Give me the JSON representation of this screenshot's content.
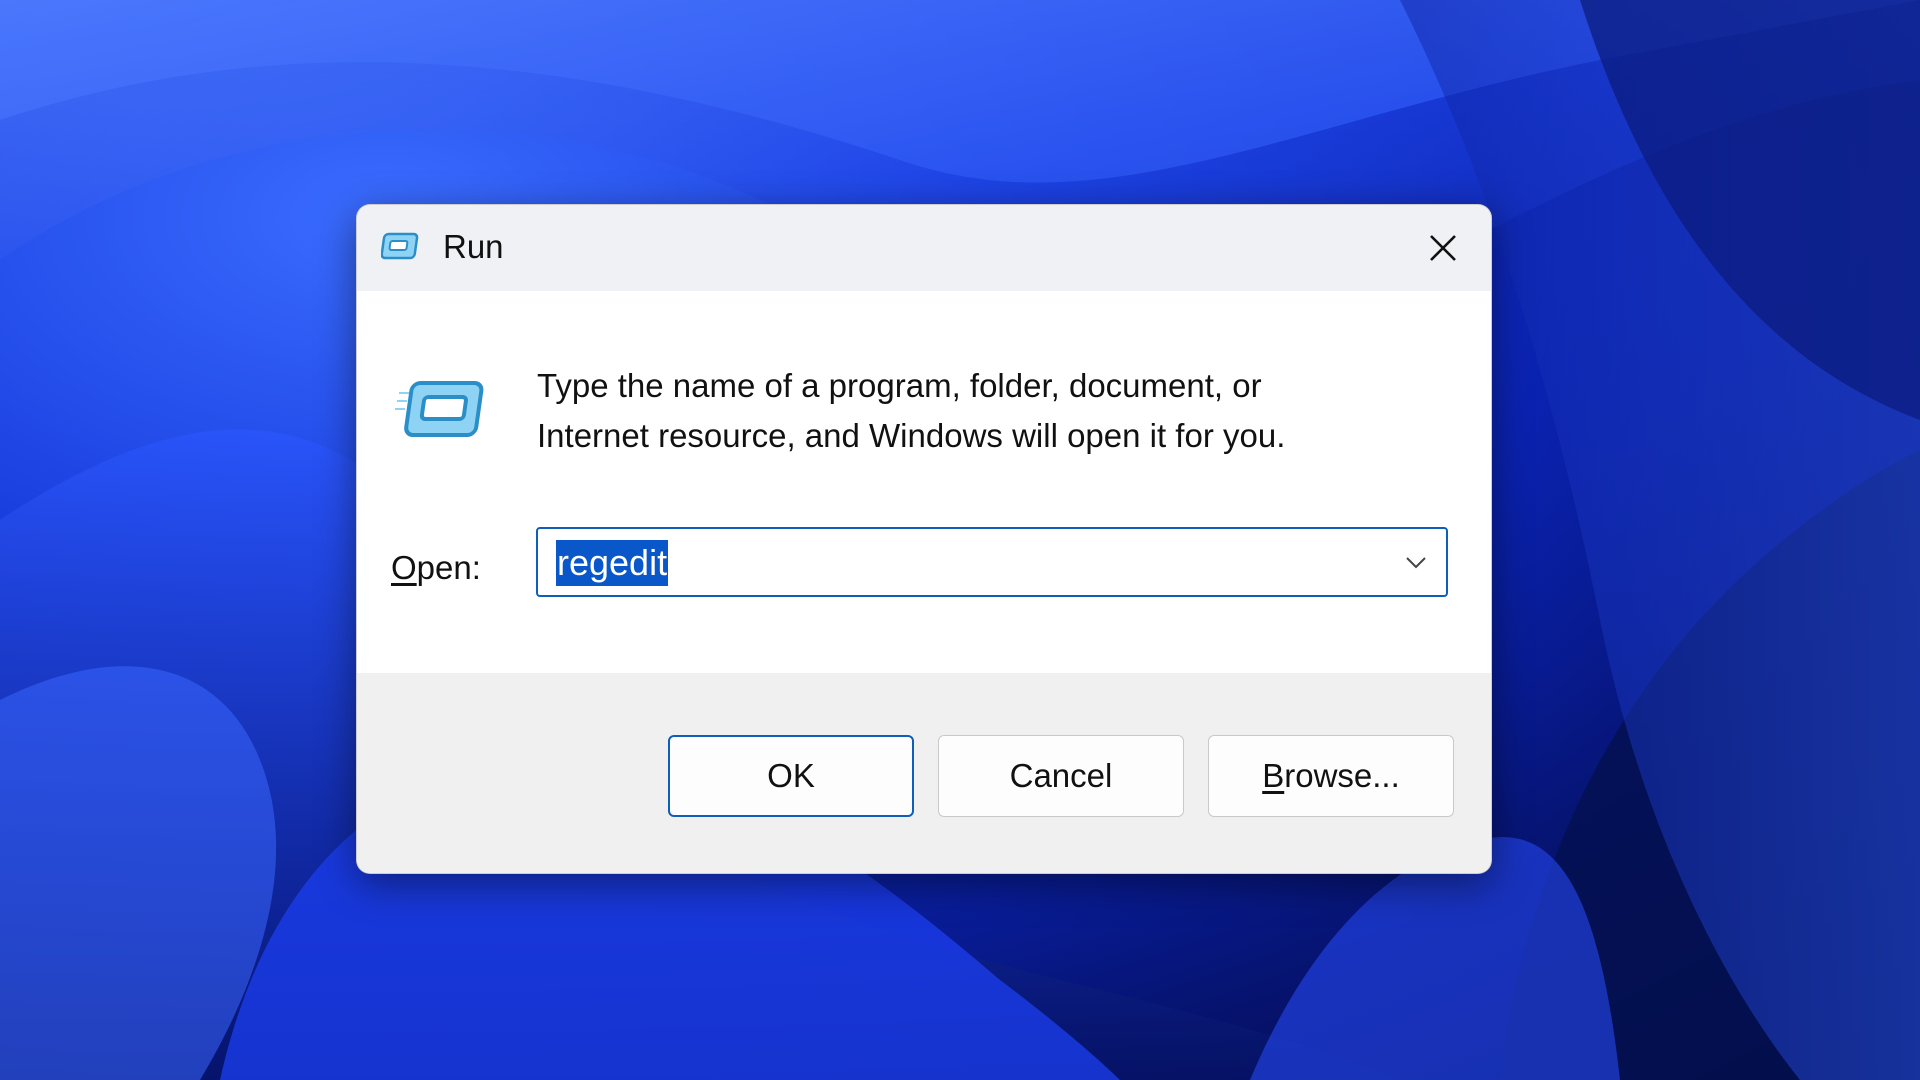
{
  "window": {
    "title": "Run",
    "icon": "run-icon",
    "close_icon": "close-icon"
  },
  "body": {
    "description_line1": "Type the name of a program, folder, document, or",
    "description_line2": "Internet resource, and Windows will open it for you.",
    "open_label_access": "O",
    "open_label_rest": "pen:",
    "open_value": "regedit",
    "dropdown_icon": "chevron-down-icon"
  },
  "buttons": {
    "ok": "OK",
    "cancel": "Cancel",
    "browse_access": "B",
    "browse_rest": "rowse..."
  },
  "colors": {
    "accent": "#0f5fb8",
    "selection": "#0a57c9",
    "titlebar": "#eff1f5",
    "footer": "#f0f0f0"
  }
}
